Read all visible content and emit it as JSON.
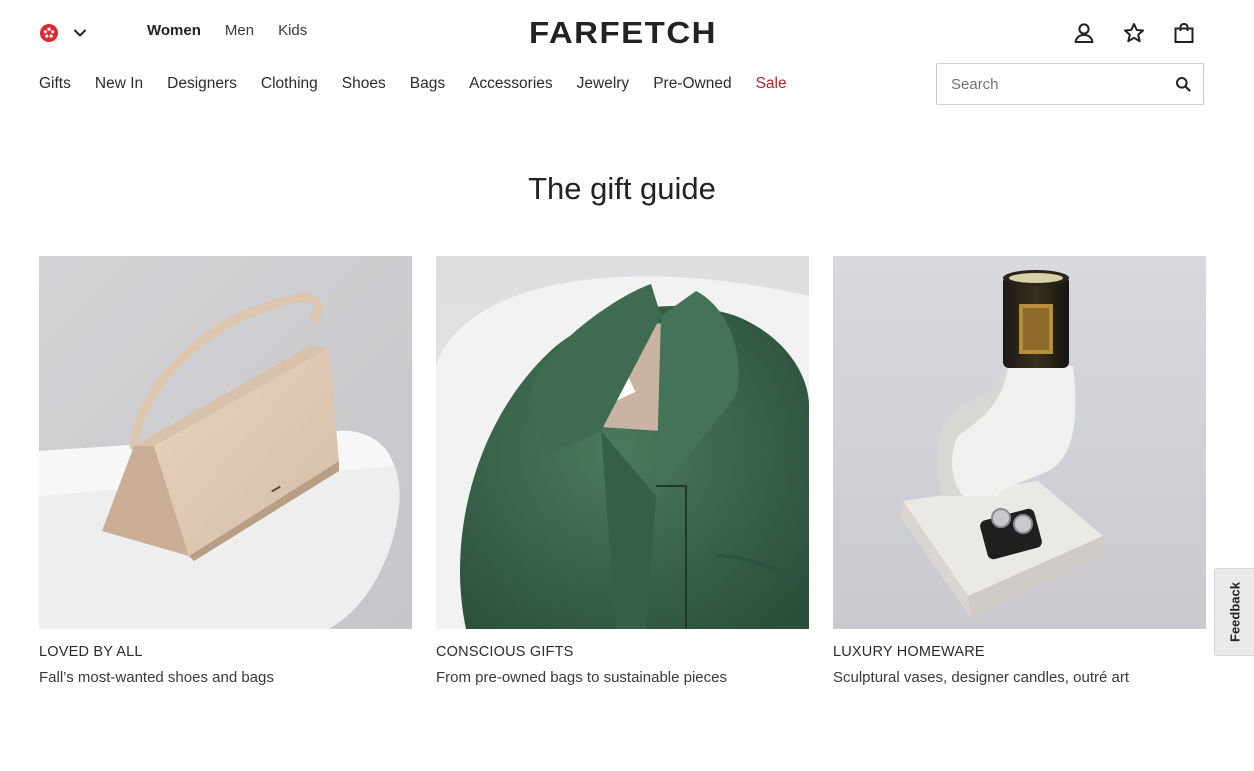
{
  "header": {
    "logo": "FARFETCH",
    "region_icon": "hong-kong-flag-icon",
    "gender_tabs": [
      {
        "label": "Women",
        "active": true
      },
      {
        "label": "Men",
        "active": false
      },
      {
        "label": "Kids",
        "active": false
      }
    ],
    "icons": [
      "account-icon",
      "wishlist-star-icon",
      "shopping-bag-icon"
    ]
  },
  "nav": {
    "items": [
      "Gifts",
      "New In",
      "Designers",
      "Clothing",
      "Shoes",
      "Bags",
      "Accessories",
      "Jewelry",
      "Pre-Owned",
      "Sale"
    ],
    "sale_color": "#b8202f"
  },
  "search": {
    "placeholder": "Search",
    "value": ""
  },
  "main": {
    "title": "The gift guide",
    "cards": [
      {
        "category": "LOVED BY ALL",
        "description": "Fall’s most-wanted shoes and bags",
        "image": "beige-handbag-on-plinth"
      },
      {
        "category": "CONSCIOUS GIFTS",
        "description": "From pre-owned bags to sustainable pieces",
        "image": "green-leather-shirt-collar"
      },
      {
        "category": "LUXURY HOMEWARE",
        "description": "Sculptural vases, designer candles, outré art",
        "image": "sculptural-vase-with-candle"
      }
    ]
  },
  "feedback": {
    "label": "Feedback"
  }
}
